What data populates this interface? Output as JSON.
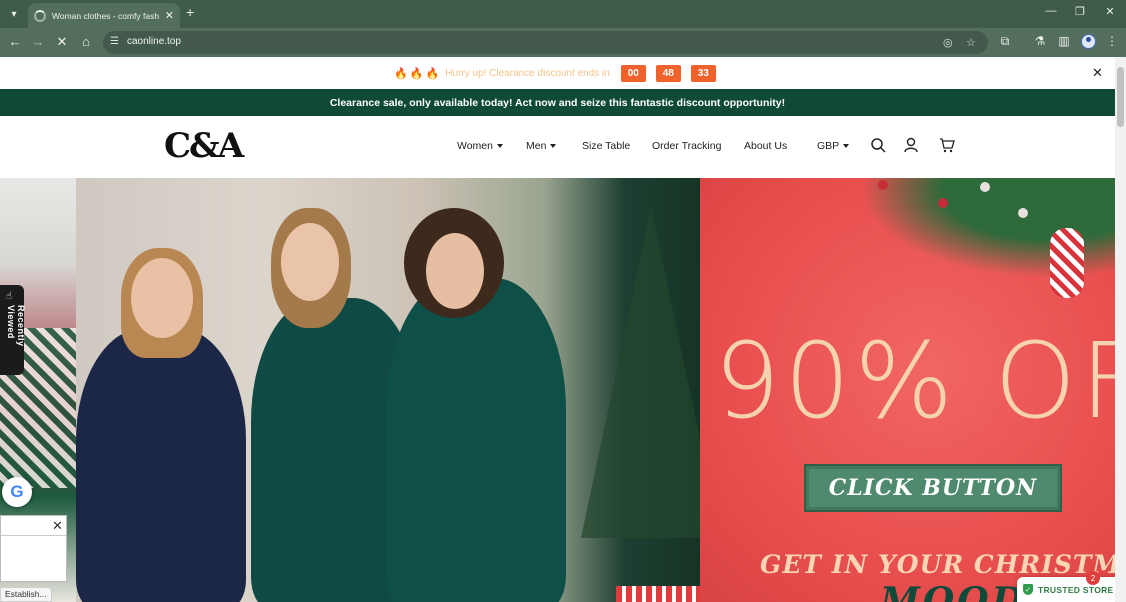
{
  "browser": {
    "tab_title": "Woman clothes - comfy fashion",
    "url": "caonline.top",
    "new_tab_symbol": "+",
    "tab_close_symbol": "✕"
  },
  "promo": {
    "flames": "🔥🔥🔥",
    "message": "Hurry up! Clearance discount ends in",
    "countdown": [
      "00",
      "48",
      "33"
    ],
    "close_symbol": "✕"
  },
  "banner": {
    "text": "Clearance sale, only available today! Act now and seize this fantastic discount opportunity!"
  },
  "header": {
    "logo": "C&A",
    "nav": [
      {
        "label": "Women",
        "dropdown": true
      },
      {
        "label": "Men",
        "dropdown": true
      },
      {
        "label": "Size Table",
        "dropdown": false
      },
      {
        "label": "Order Tracking",
        "dropdown": false
      },
      {
        "label": "About Us",
        "dropdown": false
      },
      {
        "label": "GBP",
        "dropdown": true
      }
    ]
  },
  "hero": {
    "offer": "90% OF",
    "cta": "CLICK BUTTON",
    "tagline": "GET IN YOUR CHRISTMAS",
    "tagline2": "MOOD"
  },
  "widgets": {
    "recently_viewed": "Recently Viewed",
    "google_letter": "G",
    "google_close": "✕",
    "trusted_store": "TRUSTED STORE",
    "trusted_badge": "2"
  },
  "status_bar": "Establish...",
  "colors": {
    "chrome_dark": "#3f5b4a",
    "banner_green": "#0f4a37",
    "countdown_orange": "#f0622b",
    "hero_red": "#e94f4f",
    "cta_green": "#4f8a6f"
  }
}
